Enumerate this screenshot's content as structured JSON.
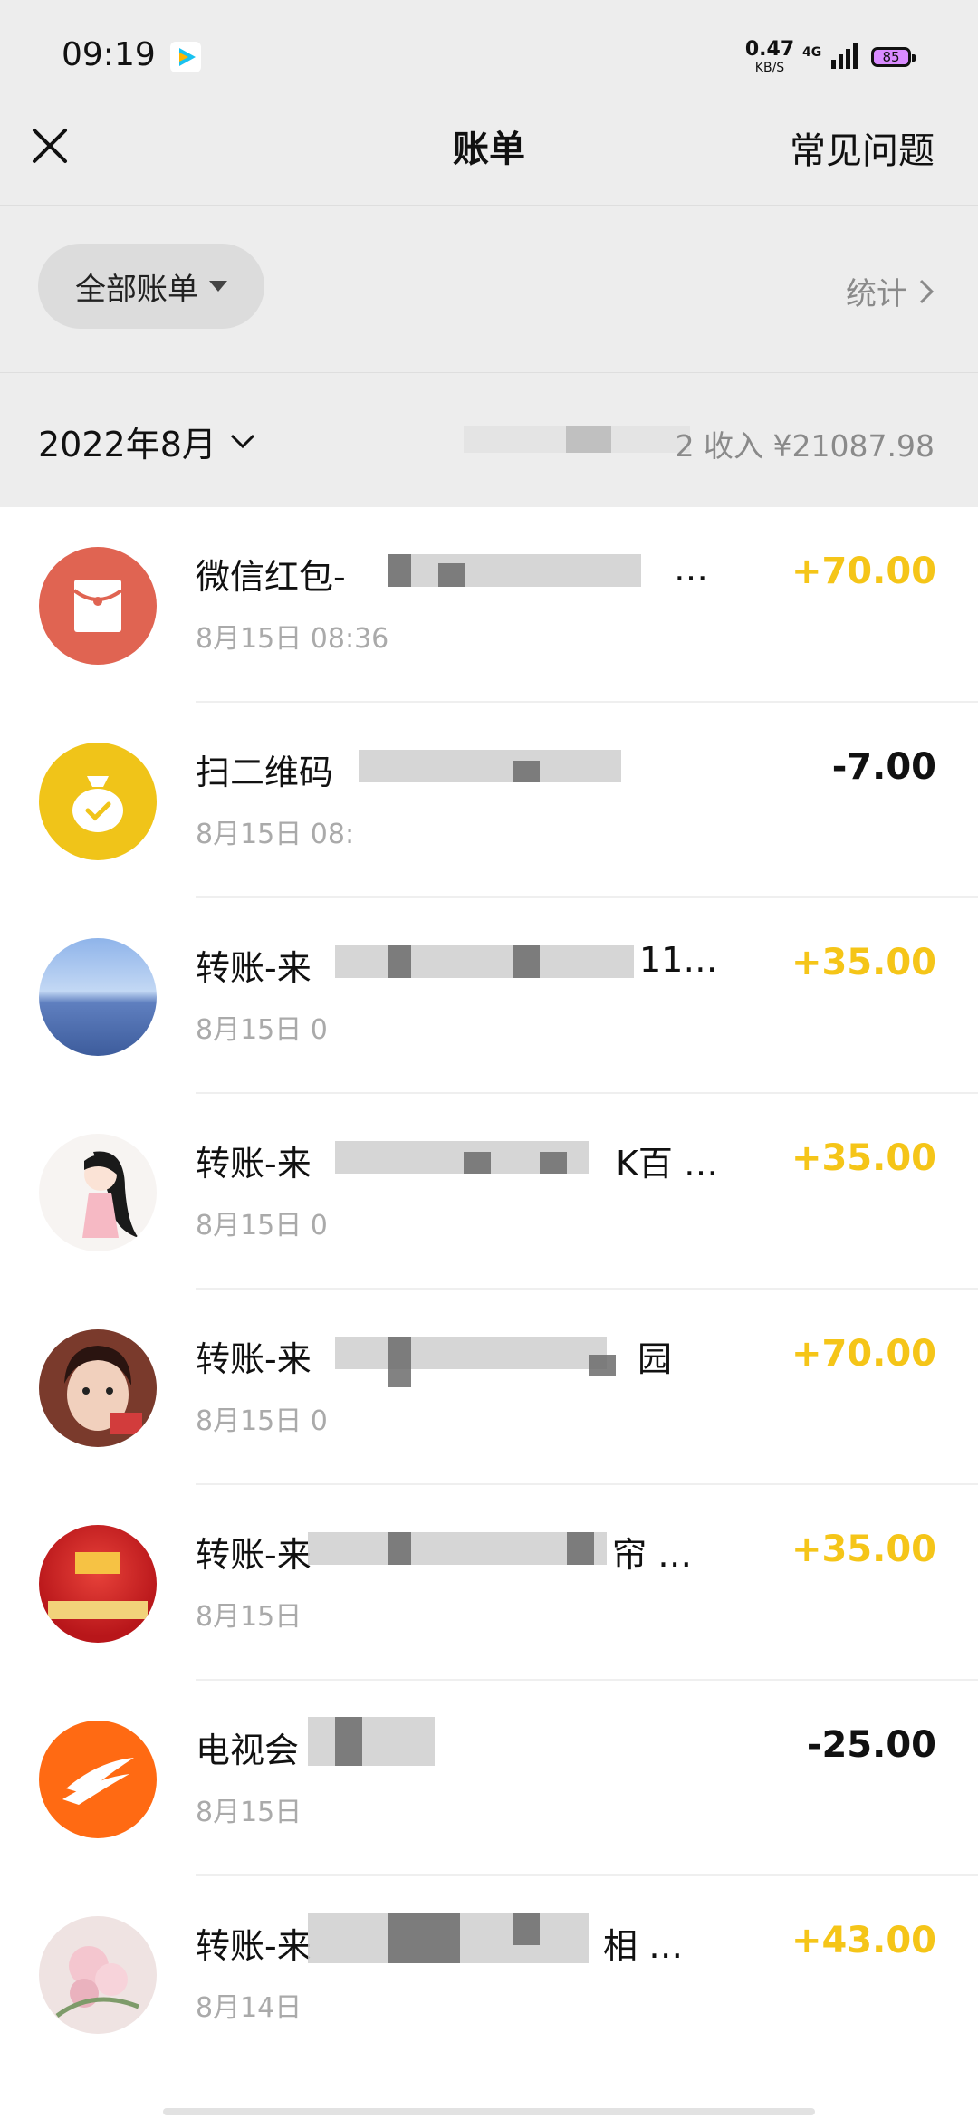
{
  "status_bar": {
    "time": "09:19",
    "speed_value": "0.47",
    "speed_unit": "KB/S",
    "network": "4G",
    "battery": "85"
  },
  "nav": {
    "title": "账单",
    "faq": "常见问题"
  },
  "filter": {
    "label": "全部账单",
    "stats": "统计"
  },
  "month": {
    "label": "2022年8月",
    "summary": "2  收入 ¥21087.98"
  },
  "colors": {
    "income": "#f5c518",
    "background": "#ededed",
    "red_packet": "#e06452",
    "qr_pay": "#f0c419",
    "tv": "#ff6a13"
  },
  "transactions": [
    {
      "title": "微信红包-",
      "title_suffix": "…",
      "time": "8月15日 08:36",
      "amount": "+70.00",
      "type": "income",
      "icon": "red-packet-icon"
    },
    {
      "title": "扫二维码",
      "title_suffix": "",
      "time": "8月15日 08:",
      "amount": "-7.00",
      "type": "expense",
      "icon": "money-bag-icon"
    },
    {
      "title": "转账-来",
      "title_suffix": "11…",
      "time": "8月15日 0",
      "amount": "+35.00",
      "type": "income",
      "icon": "sea-avatar"
    },
    {
      "title": "转账-来",
      "title_suffix": "K百 …",
      "time": "8月15日 0",
      "amount": "+35.00",
      "type": "income",
      "icon": "girl-avatar"
    },
    {
      "title": "转账-来",
      "title_suffix": "园",
      "time": "8月15日 0",
      "amount": "+70.00",
      "type": "income",
      "icon": "child-avatar"
    },
    {
      "title": "转账-来",
      "title_suffix": "帘 …",
      "time": "8月15日",
      "amount": "+35.00",
      "type": "income",
      "icon": "festival-avatar"
    },
    {
      "title": "电视会",
      "title_suffix": "",
      "time": "8月15日",
      "amount": "-25.00",
      "type": "expense",
      "icon": "tv-app-icon"
    },
    {
      "title": "转账-来",
      "title_suffix": "相 …",
      "time": "8月14日",
      "amount": "+43.00",
      "type": "income",
      "icon": "flower-avatar"
    }
  ]
}
